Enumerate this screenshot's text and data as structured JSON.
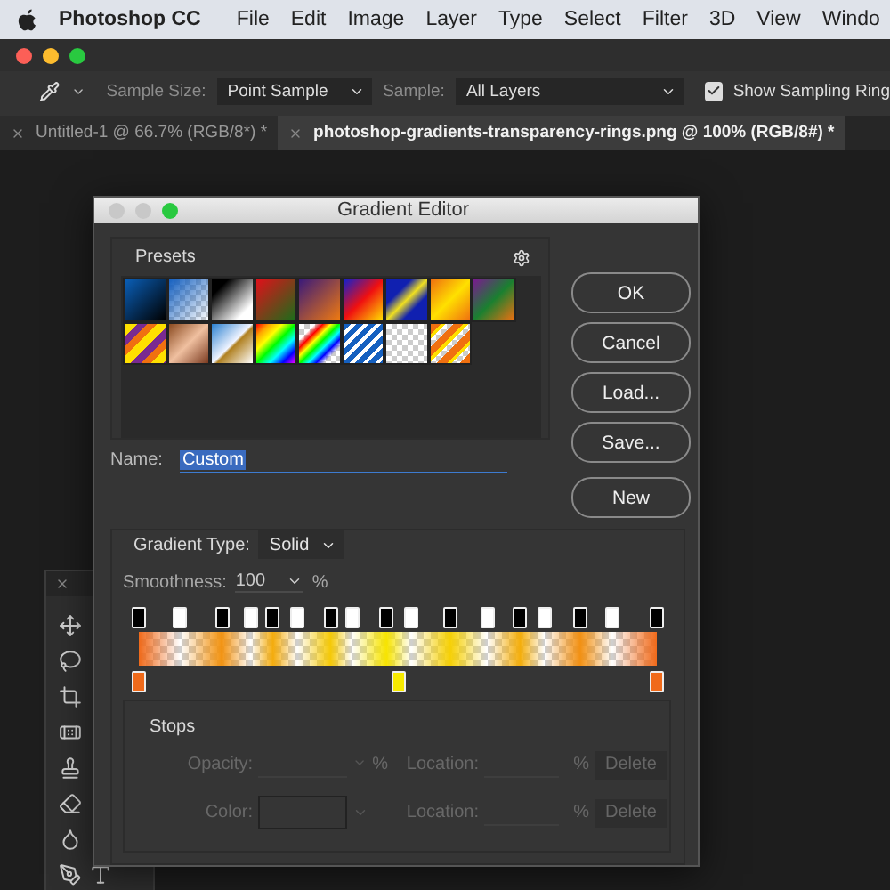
{
  "menu_bar": {
    "app": "Photoshop CC",
    "items": [
      "File",
      "Edit",
      "Image",
      "Layer",
      "Type",
      "Select",
      "Filter",
      "3D",
      "View",
      "Windo"
    ]
  },
  "options_bar": {
    "sample_size": {
      "label": "Sample Size:",
      "value": "Point Sample"
    },
    "sample": {
      "label": "Sample:",
      "value": "All Layers"
    },
    "show_sampling_ring": {
      "label": "Show Sampling Ring",
      "checked": true
    }
  },
  "document_tabs": [
    {
      "label": "Untitled-1 @ 66.7% (RGB/8*) *",
      "selected": false
    },
    {
      "label": "photoshop-gradients-transparency-rings.png @ 100% (RGB/8#) *",
      "selected": true
    }
  ],
  "dialog": {
    "title": "Gradient Editor",
    "presets_label": "Presets",
    "buttons": [
      "OK",
      "Cancel",
      "Load...",
      "Save..."
    ],
    "new_button": "New",
    "name": {
      "label": "Name:",
      "value": "Custom"
    },
    "gradient_type": {
      "label": "Gradient Type:",
      "value": "Solid"
    },
    "smoothness": {
      "label": "Smoothness:",
      "value": "100",
      "unit": "%"
    },
    "opacity_stops": [
      {
        "level": 0,
        "opaque": true
      },
      {
        "level": 0.08,
        "opaque": false
      },
      {
        "level": 0.16,
        "opaque": true
      },
      {
        "level": 0.216,
        "opaque": false
      },
      {
        "level": 0.259,
        "opaque": true
      },
      {
        "level": 0.306,
        "opaque": false
      },
      {
        "level": 0.37,
        "opaque": true
      },
      {
        "level": 0.411,
        "opaque": false
      },
      {
        "level": 0.478,
        "opaque": true
      },
      {
        "level": 0.526,
        "opaque": false
      },
      {
        "level": 0.601,
        "opaque": true
      },
      {
        "level": 0.672,
        "opaque": false
      },
      {
        "level": 0.736,
        "opaque": true
      },
      {
        "level": 0.783,
        "opaque": false
      },
      {
        "level": 0.852,
        "opaque": true
      },
      {
        "level": 0.914,
        "opaque": false
      },
      {
        "level": 1,
        "opaque": true
      }
    ],
    "color_stops": [
      {
        "level": 0,
        "color": "#f06a1a"
      },
      {
        "level": 0.5,
        "color": "#f7ea00"
      },
      {
        "level": 1,
        "color": "#f06a1a"
      }
    ],
    "stops": {
      "title": "Stops",
      "rows": [
        {
          "kind": "opacity",
          "label": "Opacity:",
          "unit": "%",
          "location_label": "Location:",
          "location_unit": "%",
          "delete": "Delete",
          "disabled": true
        },
        {
          "kind": "color",
          "label": "Color:",
          "location_label": "Location:",
          "location_unit": "%",
          "delete": "Delete",
          "disabled": true
        }
      ]
    }
  }
}
